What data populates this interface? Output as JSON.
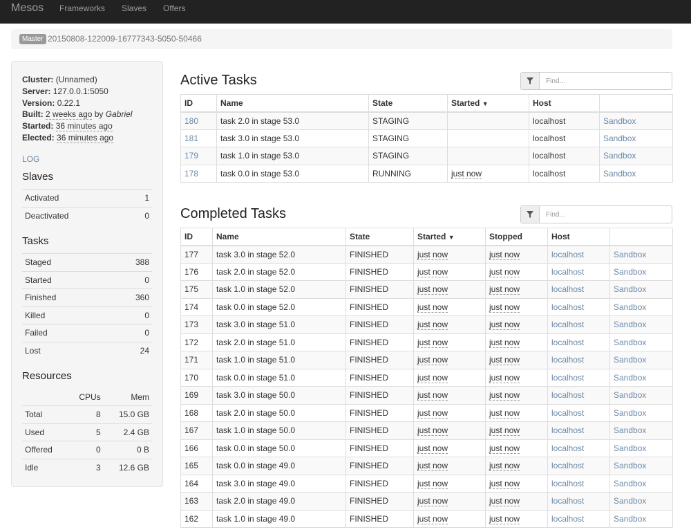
{
  "navbar": {
    "brand": "Mesos",
    "links": [
      "Frameworks",
      "Slaves",
      "Offers"
    ]
  },
  "breadcrumb": {
    "badge": "Master",
    "master_id": "20150808-122009-16777343-5050-50466"
  },
  "cluster_info": {
    "cluster": {
      "label": "Cluster:",
      "value": "(Unnamed)"
    },
    "server": {
      "label": "Server:",
      "value": "127.0.0.1:5050"
    },
    "version": {
      "label": "Version:",
      "value": "0.22.1"
    },
    "built": {
      "label": "Built:",
      "value": "2 weeks ago",
      "by": "by",
      "author": "Gabriel"
    },
    "started": {
      "label": "Started:",
      "value": "36 minutes ago"
    },
    "elected": {
      "label": "Elected:",
      "value": "36 minutes ago"
    },
    "log_link": "LOG"
  },
  "slaves": {
    "title": "Slaves",
    "rows": [
      {
        "label": "Activated",
        "value": "1"
      },
      {
        "label": "Deactivated",
        "value": "0"
      }
    ]
  },
  "tasks_summary": {
    "title": "Tasks",
    "rows": [
      {
        "label": "Staged",
        "value": "388"
      },
      {
        "label": "Started",
        "value": "0"
      },
      {
        "label": "Finished",
        "value": "360"
      },
      {
        "label": "Killed",
        "value": "0"
      },
      {
        "label": "Failed",
        "value": "0"
      },
      {
        "label": "Lost",
        "value": "24"
      }
    ]
  },
  "resources": {
    "title": "Resources",
    "headers": [
      "",
      "CPUs",
      "Mem"
    ],
    "rows": [
      {
        "label": "Total",
        "cpus": "8",
        "mem": "15.0 GB"
      },
      {
        "label": "Used",
        "cpus": "5",
        "mem": "2.4 GB"
      },
      {
        "label": "Offered",
        "cpus": "0",
        "mem": "0 B"
      },
      {
        "label": "Idle",
        "cpus": "3",
        "mem": "12.6 GB"
      }
    ]
  },
  "active_tasks": {
    "title": "Active Tasks",
    "filter_placeholder": "Find...",
    "headers": {
      "id": "ID",
      "name": "Name",
      "state": "State",
      "started": "Started",
      "sort_arrow": "▼",
      "host": "Host"
    },
    "rows": [
      {
        "id": "180",
        "name": "task 2.0 in stage 53.0",
        "state": "STAGING",
        "started": "",
        "host": "localhost",
        "sandbox": "Sandbox"
      },
      {
        "id": "181",
        "name": "task 3.0 in stage 53.0",
        "state": "STAGING",
        "started": "",
        "host": "localhost",
        "sandbox": "Sandbox"
      },
      {
        "id": "179",
        "name": "task 1.0 in stage 53.0",
        "state": "STAGING",
        "started": "",
        "host": "localhost",
        "sandbox": "Sandbox"
      },
      {
        "id": "178",
        "name": "task 0.0 in stage 53.0",
        "state": "RUNNING",
        "started": "just now",
        "host": "localhost",
        "sandbox": "Sandbox"
      }
    ]
  },
  "completed_tasks": {
    "title": "Completed Tasks",
    "filter_placeholder": "Find...",
    "headers": {
      "id": "ID",
      "name": "Name",
      "state": "State",
      "started": "Started",
      "sort_arrow": "▼",
      "stopped": "Stopped",
      "host": "Host"
    },
    "rows": [
      {
        "id": "177",
        "name": "task 3.0 in stage 52.0",
        "state": "FINISHED",
        "started": "just now",
        "stopped": "just now",
        "host": "localhost",
        "sandbox": "Sandbox"
      },
      {
        "id": "176",
        "name": "task 2.0 in stage 52.0",
        "state": "FINISHED",
        "started": "just now",
        "stopped": "just now",
        "host": "localhost",
        "sandbox": "Sandbox"
      },
      {
        "id": "175",
        "name": "task 1.0 in stage 52.0",
        "state": "FINISHED",
        "started": "just now",
        "stopped": "just now",
        "host": "localhost",
        "sandbox": "Sandbox"
      },
      {
        "id": "174",
        "name": "task 0.0 in stage 52.0",
        "state": "FINISHED",
        "started": "just now",
        "stopped": "just now",
        "host": "localhost",
        "sandbox": "Sandbox"
      },
      {
        "id": "173",
        "name": "task 3.0 in stage 51.0",
        "state": "FINISHED",
        "started": "just now",
        "stopped": "just now",
        "host": "localhost",
        "sandbox": "Sandbox"
      },
      {
        "id": "172",
        "name": "task 2.0 in stage 51.0",
        "state": "FINISHED",
        "started": "just now",
        "stopped": "just now",
        "host": "localhost",
        "sandbox": "Sandbox"
      },
      {
        "id": "171",
        "name": "task 1.0 in stage 51.0",
        "state": "FINISHED",
        "started": "just now",
        "stopped": "just now",
        "host": "localhost",
        "sandbox": "Sandbox"
      },
      {
        "id": "170",
        "name": "task 0.0 in stage 51.0",
        "state": "FINISHED",
        "started": "just now",
        "stopped": "just now",
        "host": "localhost",
        "sandbox": "Sandbox"
      },
      {
        "id": "169",
        "name": "task 3.0 in stage 50.0",
        "state": "FINISHED",
        "started": "just now",
        "stopped": "just now",
        "host": "localhost",
        "sandbox": "Sandbox"
      },
      {
        "id": "168",
        "name": "task 2.0 in stage 50.0",
        "state": "FINISHED",
        "started": "just now",
        "stopped": "just now",
        "host": "localhost",
        "sandbox": "Sandbox"
      },
      {
        "id": "167",
        "name": "task 1.0 in stage 50.0",
        "state": "FINISHED",
        "started": "just now",
        "stopped": "just now",
        "host": "localhost",
        "sandbox": "Sandbox"
      },
      {
        "id": "166",
        "name": "task 0.0 in stage 50.0",
        "state": "FINISHED",
        "started": "just now",
        "stopped": "just now",
        "host": "localhost",
        "sandbox": "Sandbox"
      },
      {
        "id": "165",
        "name": "task 0.0 in stage 49.0",
        "state": "FINISHED",
        "started": "just now",
        "stopped": "just now",
        "host": "localhost",
        "sandbox": "Sandbox"
      },
      {
        "id": "164",
        "name": "task 3.0 in stage 49.0",
        "state": "FINISHED",
        "started": "just now",
        "stopped": "just now",
        "host": "localhost",
        "sandbox": "Sandbox"
      },
      {
        "id": "163",
        "name": "task 2.0 in stage 49.0",
        "state": "FINISHED",
        "started": "just now",
        "stopped": "just now",
        "host": "localhost",
        "sandbox": "Sandbox"
      },
      {
        "id": "162",
        "name": "task 1.0 in stage 49.0",
        "state": "FINISHED",
        "started": "just now",
        "stopped": "just now",
        "host": "localhost",
        "sandbox": "Sandbox"
      }
    ]
  },
  "icons": {
    "filter": "filter-icon",
    "sort": "sort-down-icon"
  },
  "colors": {
    "navbar": "#222222",
    "link": "#6c8aa8",
    "badge": "#999999",
    "sidebar": "#f5f5f5"
  }
}
